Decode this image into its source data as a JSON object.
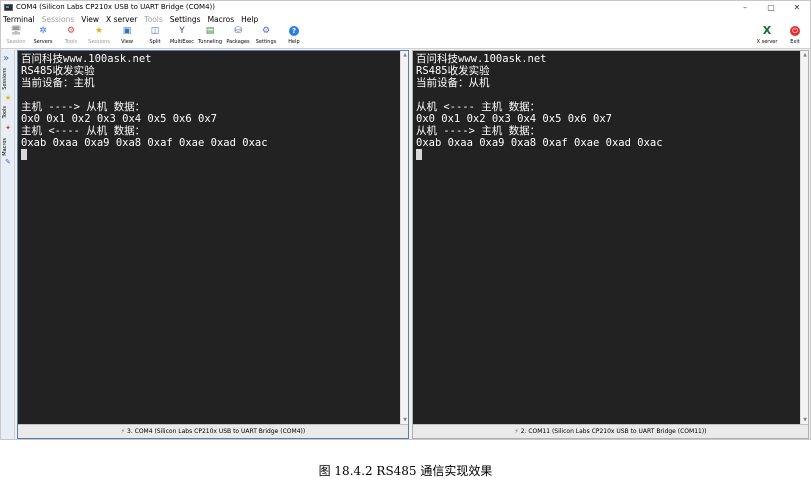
{
  "window": {
    "title": "COM4  (Silicon Labs CP210x USB to UART Bridge (COM4))",
    "controls": {
      "minimize": "–",
      "maximize": "▢",
      "close": "✕"
    }
  },
  "menu": [
    {
      "label": "Terminal",
      "enabled": true
    },
    {
      "label": "Sessions",
      "enabled": false
    },
    {
      "label": "View",
      "enabled": true
    },
    {
      "label": "X server",
      "enabled": true
    },
    {
      "label": "Tools",
      "enabled": false
    },
    {
      "label": "Settings",
      "enabled": true
    },
    {
      "label": "Macros",
      "enabled": true
    },
    {
      "label": "Help",
      "enabled": true
    }
  ],
  "toolbar": {
    "session": "Session",
    "servers": "Servers",
    "tools": "Tools",
    "sessions": "Sessions",
    "view": "View",
    "split": "Split",
    "multiexec": "MultiExec",
    "tunneling": "Tunneling",
    "packages": "Packages",
    "settings": "Settings",
    "help": "Help",
    "xserver": "X server",
    "exit": "Exit"
  },
  "sidebar": {
    "sessions": "Sessions",
    "tools": "Tools",
    "macros": "Macros"
  },
  "left_terminal": {
    "lines": [
      "百问科技www.100ask.net",
      "RS485收发实验",
      "当前设备：主机",
      "",
      "主机 ----> 从机 数据：",
      "0x0 0x1 0x2 0x3 0x4 0x5 0x6 0x7",
      "主机 <---- 从机 数据：",
      "0xab 0xaa 0xa9 0xa8 0xaf 0xae 0xad 0xac"
    ],
    "status": "3. COM4  (Silicon Labs CP210x USB to UART Bridge (COM4))"
  },
  "right_terminal": {
    "lines": [
      "百问科技www.100ask.net",
      "RS485收发实验",
      "当前设备：从机",
      "",
      "从机 <---- 主机 数据：",
      "0x0 0x1 0x2 0x3 0x4 0x5 0x6 0x7",
      "从机 ----> 主机 数据：",
      "0xab 0xaa 0xa9 0xa8 0xaf 0xae 0xad 0xac"
    ],
    "status": "2. COM11  (Silicon Labs CP210x USB to UART Bridge (COM11))"
  },
  "caption": "图  18.4.2 RS485 通信实现效果",
  "colors": {
    "terminal_bg": "#222222",
    "terminal_fg": "#ffffff",
    "active_pane_border": "#5a7db0"
  }
}
